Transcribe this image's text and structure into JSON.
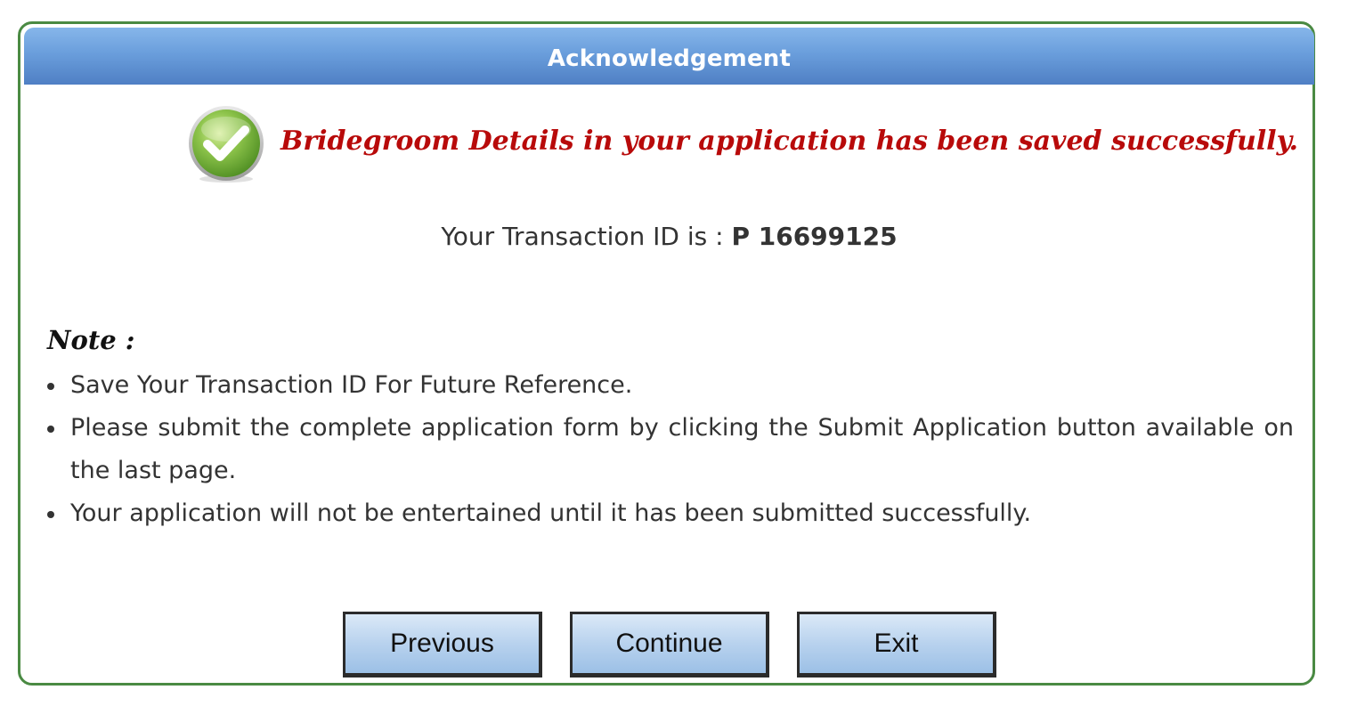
{
  "header": {
    "title": "Acknowledgement"
  },
  "success": {
    "icon": "check-circle-icon",
    "message": "Bridegroom Details in your application has been saved successfully."
  },
  "transaction": {
    "label": "Your Transaction ID is : ",
    "value": "P 16699125"
  },
  "note": {
    "heading": "Note :",
    "items": [
      "Save Your Transaction ID For Future Reference.",
      "Please submit the complete application form by clicking the Submit Application button available on the last page.",
      "Your application will not be entertained until it has been submitted successfully."
    ]
  },
  "buttons": {
    "previous": "Previous",
    "continue": "Continue",
    "exit": "Exit"
  },
  "colors": {
    "border": "#4a8a43",
    "header": "#6a9edc",
    "success_text": "#b80a0a",
    "button": "#b8d2ee"
  }
}
